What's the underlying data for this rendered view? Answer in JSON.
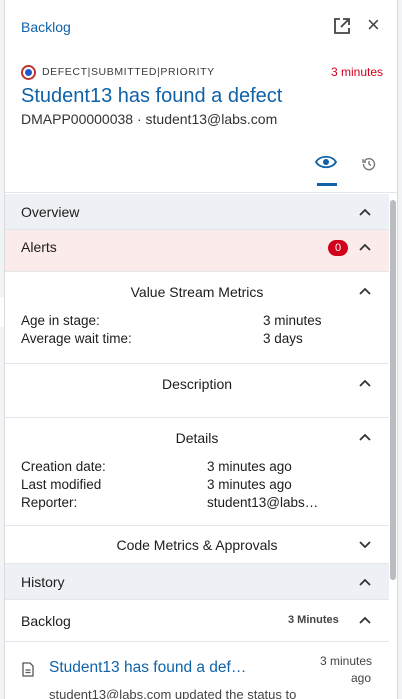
{
  "header": {
    "breadcrumb": "Backlog",
    "tags": [
      "DEFECT",
      "SUBMITTED",
      "PRIORITY"
    ],
    "time_ago": "3 minutes",
    "title": "Student13 has found a defect",
    "subtitle": "DMAPP00000038 · student13@labs.com"
  },
  "sections": {
    "overview": "Overview",
    "alerts": {
      "label": "Alerts",
      "count": "0"
    },
    "vsm": {
      "title": "Value Stream Metrics",
      "rows": [
        {
          "label": "Age in stage:",
          "value": "3 minutes"
        },
        {
          "label": "Average wait time:",
          "value": "3 days"
        }
      ]
    },
    "description": "Description",
    "details": {
      "title": "Details",
      "rows": [
        {
          "label": "Creation date:",
          "value": "3 minutes ago"
        },
        {
          "label": "Last modified",
          "value": "3 minutes ago"
        },
        {
          "label": "Reporter:",
          "value": "student13@labs…"
        }
      ]
    },
    "code_metrics": "Code Metrics & Approvals",
    "history": "History",
    "backlog": {
      "label": "Backlog",
      "time": "3 Minutes"
    },
    "history_item": {
      "title": "Student13 has found a def…",
      "time_line1": "3 minutes",
      "time_line2": "ago",
      "description": "student13@labs.com updated the status to"
    }
  },
  "colors": {
    "accent": "#0f62a8",
    "alert_red": "#d0021b",
    "alert_bg": "#fcebeb",
    "section_bg": "#edf0f4"
  },
  "icons": [
    "external-link-icon",
    "close-icon",
    "status-dot-icon",
    "eye-icon",
    "history-icon",
    "chevron-up-icon",
    "chevron-down-icon",
    "document-icon"
  ]
}
